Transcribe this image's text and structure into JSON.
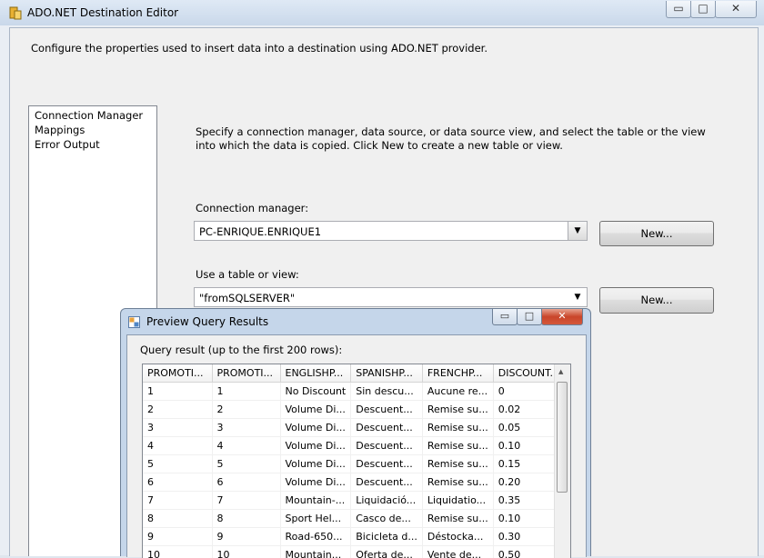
{
  "window": {
    "title": "ADO.NET Destination Editor",
    "minimize": "▭",
    "maximize": "□",
    "close": "✕"
  },
  "description": "Configure the properties used to insert data into a destination using ADO.NET provider.",
  "nav": {
    "items": [
      "Connection Manager",
      "Mappings",
      "Error Output"
    ]
  },
  "instructions": "Specify a connection manager, data source, or data source view, and select the table or the view into which the data is copied. Click New to create a new table or view.",
  "connection": {
    "label": "Connection manager:",
    "value": "PC-ENRIQUE.ENRIQUE1",
    "new_button": "New..."
  },
  "table_view": {
    "label": "Use a table or view:",
    "value": "\"fromSQLSERVER\"",
    "new_button": "New..."
  },
  "preview": {
    "title": "Preview Query Results",
    "minimize": "▭",
    "maximize": "□",
    "close": "✕",
    "query_label": "Query result (up to the first 200 rows):",
    "columns": [
      "PROMOTI...",
      "PROMOTI...",
      "ENGLISHP...",
      "SPANISHP...",
      "FRENCHP...",
      "DISCOUNT..."
    ],
    "rows": [
      [
        "1",
        "1",
        "No Discount",
        "Sin descu...",
        "Aucune re...",
        "0"
      ],
      [
        "2",
        "2",
        "Volume Di...",
        "Descuent...",
        "Remise su...",
        "0.02"
      ],
      [
        "3",
        "3",
        "Volume Di...",
        "Descuent...",
        "Remise su...",
        "0.05"
      ],
      [
        "4",
        "4",
        "Volume Di...",
        "Descuent...",
        "Remise su...",
        "0.10"
      ],
      [
        "5",
        "5",
        "Volume Di...",
        "Descuent...",
        "Remise su...",
        "0.15"
      ],
      [
        "6",
        "6",
        "Volume Di...",
        "Descuent...",
        "Remise su...",
        "0.20"
      ],
      [
        "7",
        "7",
        "Mountain-...",
        "Liquidació...",
        "Liquidatio...",
        "0.35"
      ],
      [
        "8",
        "8",
        "Sport Hel...",
        "Casco de...",
        "Remise su...",
        "0.10"
      ],
      [
        "9",
        "9",
        "Road-650...",
        "Bicicleta d...",
        "Déstocka...",
        "0.30"
      ],
      [
        "10",
        "10",
        "Mountain...",
        "Oferta de...",
        "Vente de...",
        "0.50"
      ]
    ]
  },
  "colors": {
    "titlebar": "#c9d8ea",
    "close": "#c9452a"
  }
}
